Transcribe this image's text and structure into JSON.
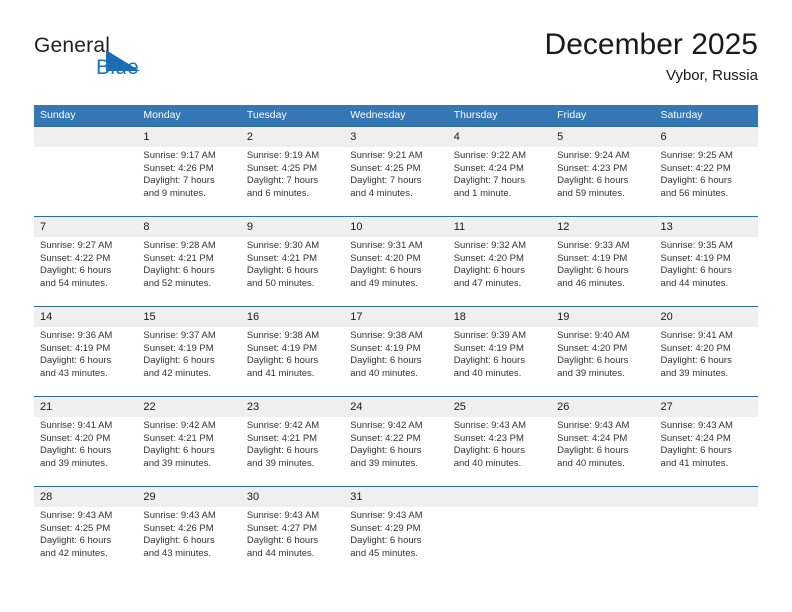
{
  "brand": {
    "line1": "General",
    "line2": "Blue",
    "triangle_color": "#1b6cb0",
    "blue_text_color": "#1b75bb"
  },
  "header": {
    "title": "December 2025",
    "location": "Vybor, Russia"
  },
  "theme": {
    "header_row_bg": "#3576b5",
    "header_row_text": "#ffffff",
    "daynum_bg": "#efefef",
    "cell_border": "#2e6da4"
  },
  "weekday_headers": [
    "Sunday",
    "Monday",
    "Tuesday",
    "Wednesday",
    "Thursday",
    "Friday",
    "Saturday"
  ],
  "weeks": [
    [
      {
        "day": "",
        "sunrise": "",
        "sunset": "",
        "daylight_line1": "",
        "daylight_line2": ""
      },
      {
        "day": "1",
        "sunrise": "Sunrise: 9:17 AM",
        "sunset": "Sunset: 4:26 PM",
        "daylight_line1": "Daylight: 7 hours",
        "daylight_line2": "and 9 minutes."
      },
      {
        "day": "2",
        "sunrise": "Sunrise: 9:19 AM",
        "sunset": "Sunset: 4:25 PM",
        "daylight_line1": "Daylight: 7 hours",
        "daylight_line2": "and 6 minutes."
      },
      {
        "day": "3",
        "sunrise": "Sunrise: 9:21 AM",
        "sunset": "Sunset: 4:25 PM",
        "daylight_line1": "Daylight: 7 hours",
        "daylight_line2": "and 4 minutes."
      },
      {
        "day": "4",
        "sunrise": "Sunrise: 9:22 AM",
        "sunset": "Sunset: 4:24 PM",
        "daylight_line1": "Daylight: 7 hours",
        "daylight_line2": "and 1 minute."
      },
      {
        "day": "5",
        "sunrise": "Sunrise: 9:24 AM",
        "sunset": "Sunset: 4:23 PM",
        "daylight_line1": "Daylight: 6 hours",
        "daylight_line2": "and 59 minutes."
      },
      {
        "day": "6",
        "sunrise": "Sunrise: 9:25 AM",
        "sunset": "Sunset: 4:22 PM",
        "daylight_line1": "Daylight: 6 hours",
        "daylight_line2": "and 56 minutes."
      }
    ],
    [
      {
        "day": "7",
        "sunrise": "Sunrise: 9:27 AM",
        "sunset": "Sunset: 4:22 PM",
        "daylight_line1": "Daylight: 6 hours",
        "daylight_line2": "and 54 minutes."
      },
      {
        "day": "8",
        "sunrise": "Sunrise: 9:28 AM",
        "sunset": "Sunset: 4:21 PM",
        "daylight_line1": "Daylight: 6 hours",
        "daylight_line2": "and 52 minutes."
      },
      {
        "day": "9",
        "sunrise": "Sunrise: 9:30 AM",
        "sunset": "Sunset: 4:21 PM",
        "daylight_line1": "Daylight: 6 hours",
        "daylight_line2": "and 50 minutes."
      },
      {
        "day": "10",
        "sunrise": "Sunrise: 9:31 AM",
        "sunset": "Sunset: 4:20 PM",
        "daylight_line1": "Daylight: 6 hours",
        "daylight_line2": "and 49 minutes."
      },
      {
        "day": "11",
        "sunrise": "Sunrise: 9:32 AM",
        "sunset": "Sunset: 4:20 PM",
        "daylight_line1": "Daylight: 6 hours",
        "daylight_line2": "and 47 minutes."
      },
      {
        "day": "12",
        "sunrise": "Sunrise: 9:33 AM",
        "sunset": "Sunset: 4:19 PM",
        "daylight_line1": "Daylight: 6 hours",
        "daylight_line2": "and 46 minutes."
      },
      {
        "day": "13",
        "sunrise": "Sunrise: 9:35 AM",
        "sunset": "Sunset: 4:19 PM",
        "daylight_line1": "Daylight: 6 hours",
        "daylight_line2": "and 44 minutes."
      }
    ],
    [
      {
        "day": "14",
        "sunrise": "Sunrise: 9:36 AM",
        "sunset": "Sunset: 4:19 PM",
        "daylight_line1": "Daylight: 6 hours",
        "daylight_line2": "and 43 minutes."
      },
      {
        "day": "15",
        "sunrise": "Sunrise: 9:37 AM",
        "sunset": "Sunset: 4:19 PM",
        "daylight_line1": "Daylight: 6 hours",
        "daylight_line2": "and 42 minutes."
      },
      {
        "day": "16",
        "sunrise": "Sunrise: 9:38 AM",
        "sunset": "Sunset: 4:19 PM",
        "daylight_line1": "Daylight: 6 hours",
        "daylight_line2": "and 41 minutes."
      },
      {
        "day": "17",
        "sunrise": "Sunrise: 9:38 AM",
        "sunset": "Sunset: 4:19 PM",
        "daylight_line1": "Daylight: 6 hours",
        "daylight_line2": "and 40 minutes."
      },
      {
        "day": "18",
        "sunrise": "Sunrise: 9:39 AM",
        "sunset": "Sunset: 4:19 PM",
        "daylight_line1": "Daylight: 6 hours",
        "daylight_line2": "and 40 minutes."
      },
      {
        "day": "19",
        "sunrise": "Sunrise: 9:40 AM",
        "sunset": "Sunset: 4:20 PM",
        "daylight_line1": "Daylight: 6 hours",
        "daylight_line2": "and 39 minutes."
      },
      {
        "day": "20",
        "sunrise": "Sunrise: 9:41 AM",
        "sunset": "Sunset: 4:20 PM",
        "daylight_line1": "Daylight: 6 hours",
        "daylight_line2": "and 39 minutes."
      }
    ],
    [
      {
        "day": "21",
        "sunrise": "Sunrise: 9:41 AM",
        "sunset": "Sunset: 4:20 PM",
        "daylight_line1": "Daylight: 6 hours",
        "daylight_line2": "and 39 minutes."
      },
      {
        "day": "22",
        "sunrise": "Sunrise: 9:42 AM",
        "sunset": "Sunset: 4:21 PM",
        "daylight_line1": "Daylight: 6 hours",
        "daylight_line2": "and 39 minutes."
      },
      {
        "day": "23",
        "sunrise": "Sunrise: 9:42 AM",
        "sunset": "Sunset: 4:21 PM",
        "daylight_line1": "Daylight: 6 hours",
        "daylight_line2": "and 39 minutes."
      },
      {
        "day": "24",
        "sunrise": "Sunrise: 9:42 AM",
        "sunset": "Sunset: 4:22 PM",
        "daylight_line1": "Daylight: 6 hours",
        "daylight_line2": "and 39 minutes."
      },
      {
        "day": "25",
        "sunrise": "Sunrise: 9:43 AM",
        "sunset": "Sunset: 4:23 PM",
        "daylight_line1": "Daylight: 6 hours",
        "daylight_line2": "and 40 minutes."
      },
      {
        "day": "26",
        "sunrise": "Sunrise: 9:43 AM",
        "sunset": "Sunset: 4:24 PM",
        "daylight_line1": "Daylight: 6 hours",
        "daylight_line2": "and 40 minutes."
      },
      {
        "day": "27",
        "sunrise": "Sunrise: 9:43 AM",
        "sunset": "Sunset: 4:24 PM",
        "daylight_line1": "Daylight: 6 hours",
        "daylight_line2": "and 41 minutes."
      }
    ],
    [
      {
        "day": "28",
        "sunrise": "Sunrise: 9:43 AM",
        "sunset": "Sunset: 4:25 PM",
        "daylight_line1": "Daylight: 6 hours",
        "daylight_line2": "and 42 minutes."
      },
      {
        "day": "29",
        "sunrise": "Sunrise: 9:43 AM",
        "sunset": "Sunset: 4:26 PM",
        "daylight_line1": "Daylight: 6 hours",
        "daylight_line2": "and 43 minutes."
      },
      {
        "day": "30",
        "sunrise": "Sunrise: 9:43 AM",
        "sunset": "Sunset: 4:27 PM",
        "daylight_line1": "Daylight: 6 hours",
        "daylight_line2": "and 44 minutes."
      },
      {
        "day": "31",
        "sunrise": "Sunrise: 9:43 AM",
        "sunset": "Sunset: 4:29 PM",
        "daylight_line1": "Daylight: 6 hours",
        "daylight_line2": "and 45 minutes."
      },
      {
        "day": "",
        "sunrise": "",
        "sunset": "",
        "daylight_line1": "",
        "daylight_line2": ""
      },
      {
        "day": "",
        "sunrise": "",
        "sunset": "",
        "daylight_line1": "",
        "daylight_line2": ""
      },
      {
        "day": "",
        "sunrise": "",
        "sunset": "",
        "daylight_line1": "",
        "daylight_line2": ""
      }
    ]
  ]
}
